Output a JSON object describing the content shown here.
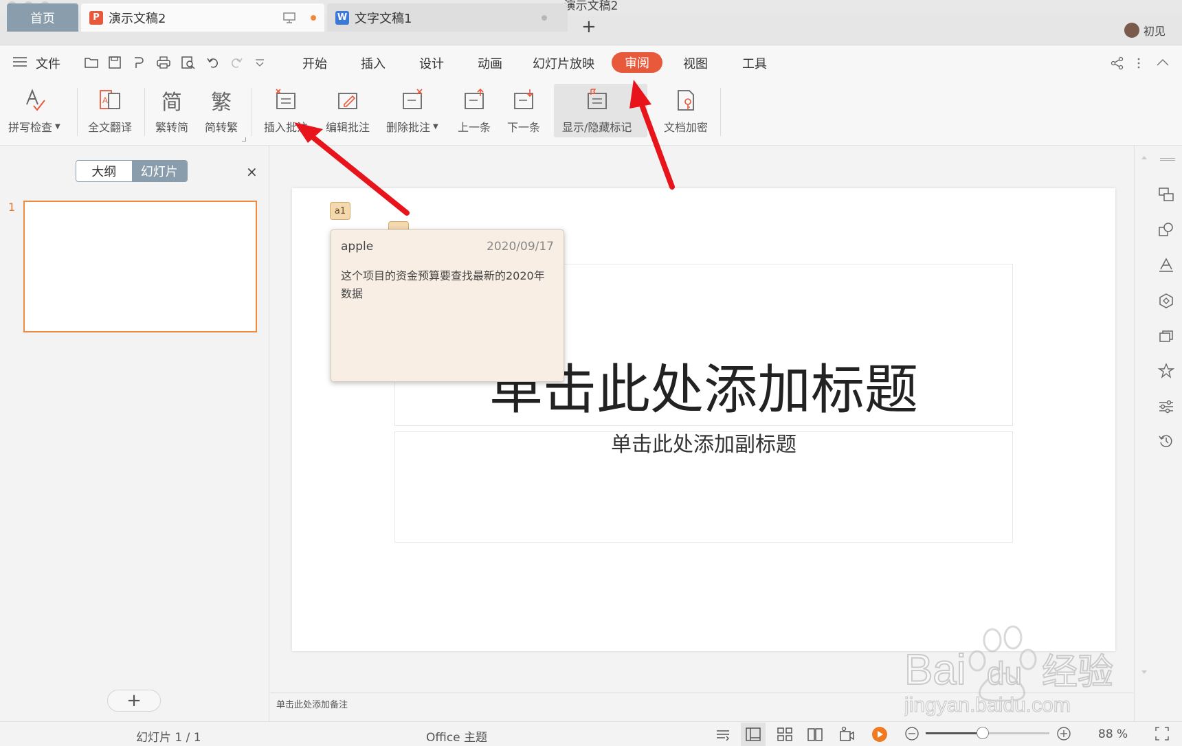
{
  "window": {
    "title": "演示文稿2"
  },
  "tabs": {
    "home": "首页",
    "doc1": {
      "label": "演示文稿2",
      "icon": "P"
    },
    "doc2": {
      "label": "文字文稿1",
      "icon": "W"
    },
    "add": "+"
  },
  "user": {
    "name": "初见"
  },
  "menu": {
    "file": "文件",
    "items": [
      "开始",
      "插入",
      "设计",
      "动画",
      "幻灯片放映",
      "审阅",
      "视图",
      "工具"
    ],
    "active": "审阅"
  },
  "ribbon": {
    "spell_check": "拼写检查",
    "translate": "全文翻译",
    "trad_to_simp": "繁转简",
    "simp_to_trad": "简转繁",
    "trad_icon_text": "繁",
    "simp_icon_text": "简",
    "insert_comment": "插入批注",
    "edit_comment": "编辑批注",
    "delete_comment": "删除批注",
    "previous": "上一条",
    "next": "下一条",
    "toggle_markup": "显示/隐藏标记",
    "encrypt": "文档加密"
  },
  "left_panel": {
    "outline_tab": "大纲",
    "slides_tab": "幻灯片",
    "close": "×",
    "slide_number": "1",
    "add_slide": "+"
  },
  "slide": {
    "title_placeholder": "单击此处添加标题",
    "subtitle_placeholder": "单击此处添加副标题",
    "comment_marker": "a1"
  },
  "comment": {
    "author": "apple",
    "date": "2020/09/17",
    "text": "这个项目的资金预算要查找最新的2020年数据"
  },
  "notes": {
    "placeholder": "单击此处添加备注"
  },
  "status": {
    "slide_indicator": "幻灯片 1 / 1",
    "theme": "Office 主题",
    "zoom": "88 %",
    "zoom_fraction": 0.46
  },
  "watermark": {
    "brand": "Bai",
    "brand2": "du",
    "brand_cn": "经验",
    "url": "jingyan.baidu.com"
  },
  "colors": {
    "accent": "#e8583a",
    "highlight_orange": "#f08a3c",
    "arrow_red": "#e8141b",
    "tab_blue": "#8a9dad"
  }
}
